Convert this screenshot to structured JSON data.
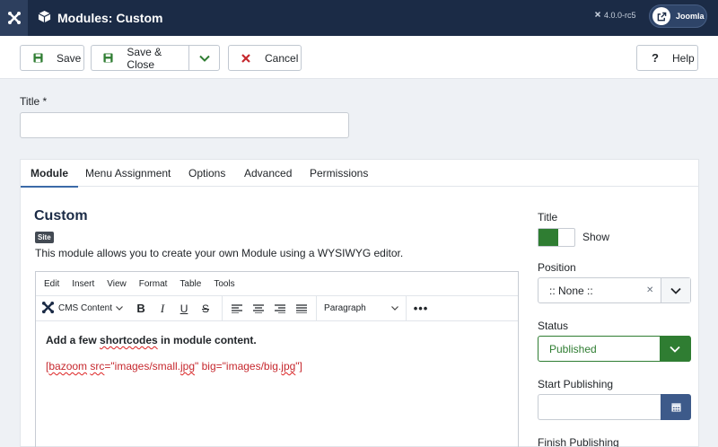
{
  "header": {
    "title": "Modules: Custom",
    "version": "4.0.0-rc5",
    "user_label": "Joomla"
  },
  "toolbar": {
    "save_label": "Save",
    "save_close_label": "Save & Close",
    "cancel_label": "Cancel",
    "help_label": "Help"
  },
  "form": {
    "title_label": "Title *",
    "title_value": ""
  },
  "tabs": [
    "Module",
    "Menu Assignment",
    "Options",
    "Advanced",
    "Permissions"
  ],
  "module": {
    "heading": "Custom",
    "badge": "Site",
    "description": "This module allows you to create your own Module using a WYSIWYG editor."
  },
  "editor": {
    "menu": [
      "Edit",
      "Insert",
      "View",
      "Format",
      "Table",
      "Tools"
    ],
    "cms_content_label": "CMS Content",
    "format_select": "Paragraph",
    "content_line1_a": "Add a few ",
    "content_line1_b": "shortcodes",
    "content_line1_c": " in module content.",
    "content_line2_a": "[",
    "content_line2_b": "bazoom",
    "content_line2_c": " ",
    "content_line2_d": "src",
    "content_line2_e": "=\"images/small.",
    "content_line2_f": "jpg",
    "content_line2_g": "\" big=\"images/big.",
    "content_line2_h": "jpg",
    "content_line2_i": "\"]"
  },
  "sidebar": {
    "title_label": "Title",
    "title_toggle": "Show",
    "position_label": "Position",
    "position_value": ":: None ::",
    "status_label": "Status",
    "status_value": "Published",
    "start_label": "Start Publishing",
    "finish_label": "Finish Publishing"
  },
  "colors": {
    "header_bg": "#1b2b46",
    "published_green": "#2f7d32",
    "cancel_red": "#c6282e",
    "calendar_blue": "#3d5a8a"
  }
}
